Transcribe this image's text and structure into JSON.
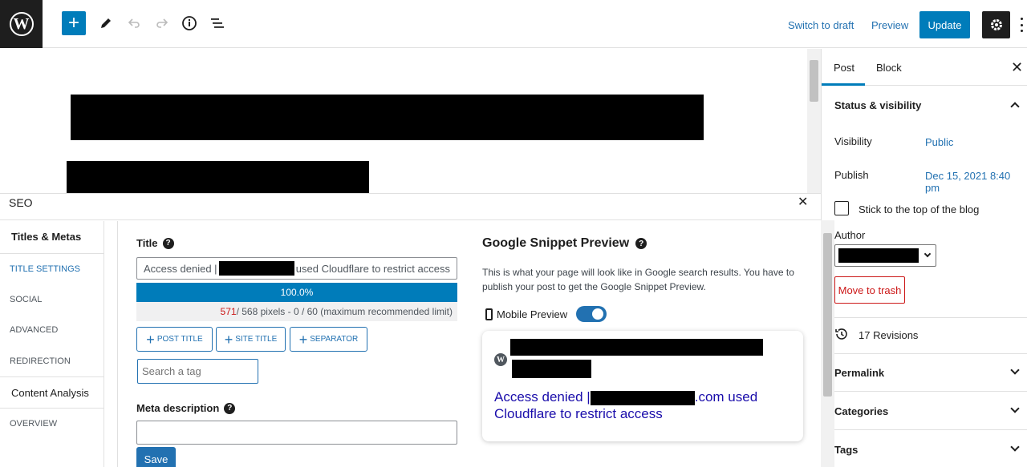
{
  "toolbar": {
    "logo": "W",
    "add_icon": "plus-icon",
    "switch_to_draft": "Switch to draft",
    "preview": "Preview",
    "update": "Update"
  },
  "sidebar": {
    "tabs": [
      "Post",
      "Block"
    ],
    "status_visibility": "Status & visibility",
    "visibility_label": "Visibility",
    "visibility_value": "Public",
    "publish_label": "Publish",
    "publish_value": "Dec 15, 2021 8:40 pm",
    "sticky_label": "Stick to the top of the blog",
    "author_label": "Author",
    "trash": "Move to trash",
    "revisions": "17 Revisions",
    "permalink": "Permalink",
    "categories": "Categories",
    "tags": "Tags"
  },
  "seo": {
    "title": "SEO",
    "nav": [
      {
        "label": "Titles & Metas"
      },
      {
        "label": "TITLE SETTINGS"
      },
      {
        "label": "SOCIAL"
      },
      {
        "label": "ADVANCED"
      },
      {
        "label": "REDIRECTION"
      },
      {
        "label": "Content Analysis"
      },
      {
        "label": "OVERVIEW"
      }
    ],
    "title_label": "Title",
    "title_prefix": "Access denied |",
    "title_suffix": "used Cloudflare to restrict access",
    "progress": "100.0%",
    "progress_fraction": 1.0,
    "pixels_used": "571",
    "pixels_info": " / 568 pixels - 0 / 60 (maximum recommended limit)",
    "tag_buttons": [
      "POST TITLE",
      "SITE TITLE",
      "SEPARATOR"
    ],
    "search_tag_placeholder": "Search a tag",
    "meta_label": "Meta description",
    "save": "Save",
    "snippet_title": "Google Snippet Preview",
    "snippet_desc": "This is what your page will look like in Google search results. You have to publish your post to get the Google Snippet Preview.",
    "mobile_preview": "Mobile Preview",
    "snippet_link_prefix": "Access denied |",
    "snippet_link_mid": ".com used",
    "snippet_link_end": "Cloudflare to restrict access"
  },
  "colors": {
    "accent": "#007cba",
    "link": "#2271b1",
    "danger": "#cc1818",
    "serp_link": "#1a0dab"
  }
}
